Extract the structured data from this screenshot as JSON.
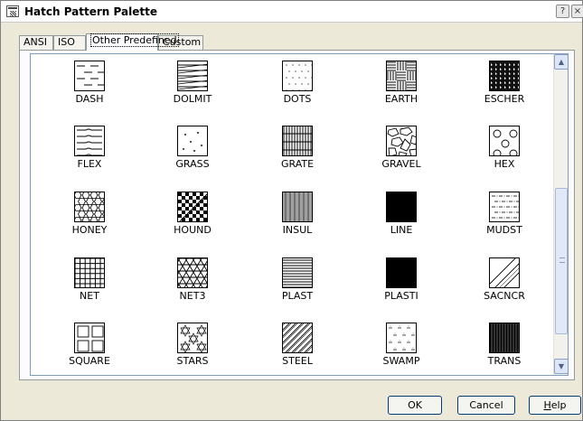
{
  "window": {
    "title": "Hatch Pattern Palette",
    "help_glyph": "?",
    "close_glyph": "×"
  },
  "tabs": [
    {
      "label": "ANSI",
      "active": false
    },
    {
      "label": "ISO",
      "active": false
    },
    {
      "label": "Other Predefined",
      "active": true
    },
    {
      "label": "Custom",
      "active": false
    }
  ],
  "patterns": [
    {
      "label": "DASH",
      "icon": "dash-pattern-icon"
    },
    {
      "label": "DOLMIT",
      "icon": "dolmit-pattern-icon"
    },
    {
      "label": "DOTS",
      "icon": "dots-pattern-icon"
    },
    {
      "label": "EARTH",
      "icon": "earth-pattern-icon"
    },
    {
      "label": "ESCHER",
      "icon": "escher-pattern-icon"
    },
    {
      "label": "FLEX",
      "icon": "flex-pattern-icon"
    },
    {
      "label": "GRASS",
      "icon": "grass-pattern-icon"
    },
    {
      "label": "GRATE",
      "icon": "grate-pattern-icon"
    },
    {
      "label": "GRAVEL",
      "icon": "gravel-pattern-icon"
    },
    {
      "label": "HEX",
      "icon": "hex-pattern-icon"
    },
    {
      "label": "HONEY",
      "icon": "honey-pattern-icon"
    },
    {
      "label": "HOUND",
      "icon": "hound-pattern-icon"
    },
    {
      "label": "INSUL",
      "icon": "insul-pattern-icon"
    },
    {
      "label": "LINE",
      "icon": "line-pattern-icon"
    },
    {
      "label": "MUDST",
      "icon": "mudst-pattern-icon"
    },
    {
      "label": "NET",
      "icon": "net-pattern-icon"
    },
    {
      "label": "NET3",
      "icon": "net3-pattern-icon"
    },
    {
      "label": "PLAST",
      "icon": "plast-pattern-icon"
    },
    {
      "label": "PLASTI",
      "icon": "plasti-pattern-icon"
    },
    {
      "label": "SACNCR",
      "icon": "sacncr-pattern-icon"
    },
    {
      "label": "SQUARE",
      "icon": "square-pattern-icon"
    },
    {
      "label": "STARS",
      "icon": "stars-pattern-icon"
    },
    {
      "label": "STEEL",
      "icon": "steel-pattern-icon"
    },
    {
      "label": "SWAMP",
      "icon": "swamp-pattern-icon"
    },
    {
      "label": "TRANS",
      "icon": "trans-pattern-icon"
    }
  ],
  "buttons": {
    "ok": "OK",
    "cancel": "Cancel",
    "help_first": "H",
    "help_rest": "elp"
  },
  "scrollbar": {
    "up_glyph": "▲",
    "down_glyph": "▼"
  }
}
